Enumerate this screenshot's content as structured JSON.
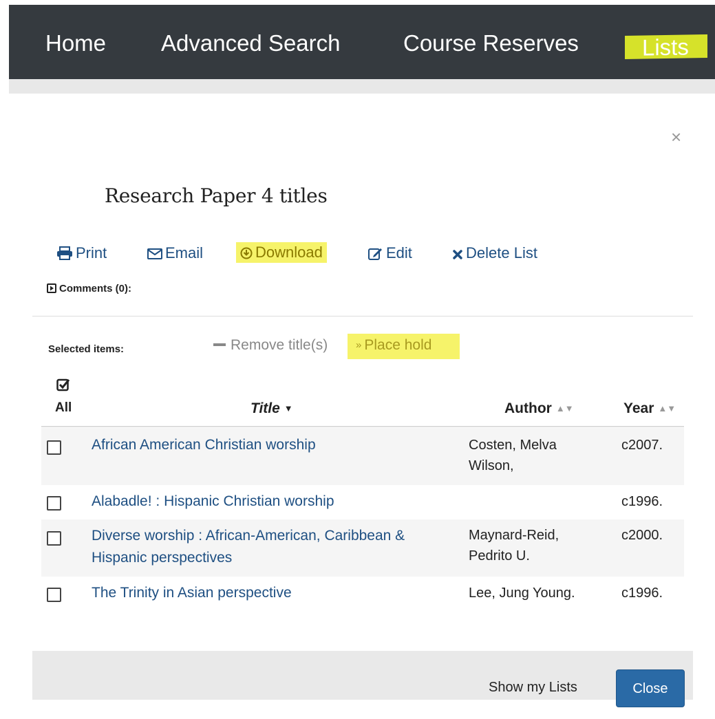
{
  "nav": {
    "items": [
      "Home",
      "Advanced Search",
      "Course Reserves",
      "Lists"
    ]
  },
  "modal": {
    "close_icon": "×",
    "title": "Research Paper 4 titles",
    "tools": {
      "print": "Print",
      "email": "Email",
      "download": "Download",
      "edit": "Edit",
      "delete": "Delete List"
    },
    "comments": "Comments (0):",
    "selected_label": "Selected items:",
    "remove_titles": "Remove title(s)",
    "place_hold": "Place hold",
    "table": {
      "all_label": "All",
      "headers": {
        "title": "Title",
        "author": "Author",
        "year": "Year"
      },
      "rows": [
        {
          "title": "African American Christian worship",
          "author": "Costen, Melva Wilson,",
          "year": "c2007."
        },
        {
          "title": "Alabadle! : Hispanic Christian worship",
          "author": "",
          "year": "c1996."
        },
        {
          "title": "Diverse worship : African-American, Caribbean & Hispanic perspectives",
          "author": "Maynard-Reid, Pedrito U.",
          "year": "c2000."
        },
        {
          "title": "The Trinity in Asian perspective",
          "author": "Lee, Jung Young.",
          "year": "c1996."
        }
      ]
    },
    "footer": {
      "show_lists": "Show my Lists",
      "close": "Close"
    }
  },
  "colors": {
    "navbar": "#353a3f",
    "highlight": "#f6f36a",
    "link": "#1e4f82",
    "primary_button": "#2a6aa6"
  },
  "icons": [
    "print-icon",
    "envelope-icon",
    "download-circle-icon",
    "edit-icon",
    "times-icon",
    "caret-square-icon",
    "minus-icon",
    "double-chevron-down-icon",
    "check-square-icon",
    "sort-caret-down-icon",
    "sort-icon"
  ]
}
